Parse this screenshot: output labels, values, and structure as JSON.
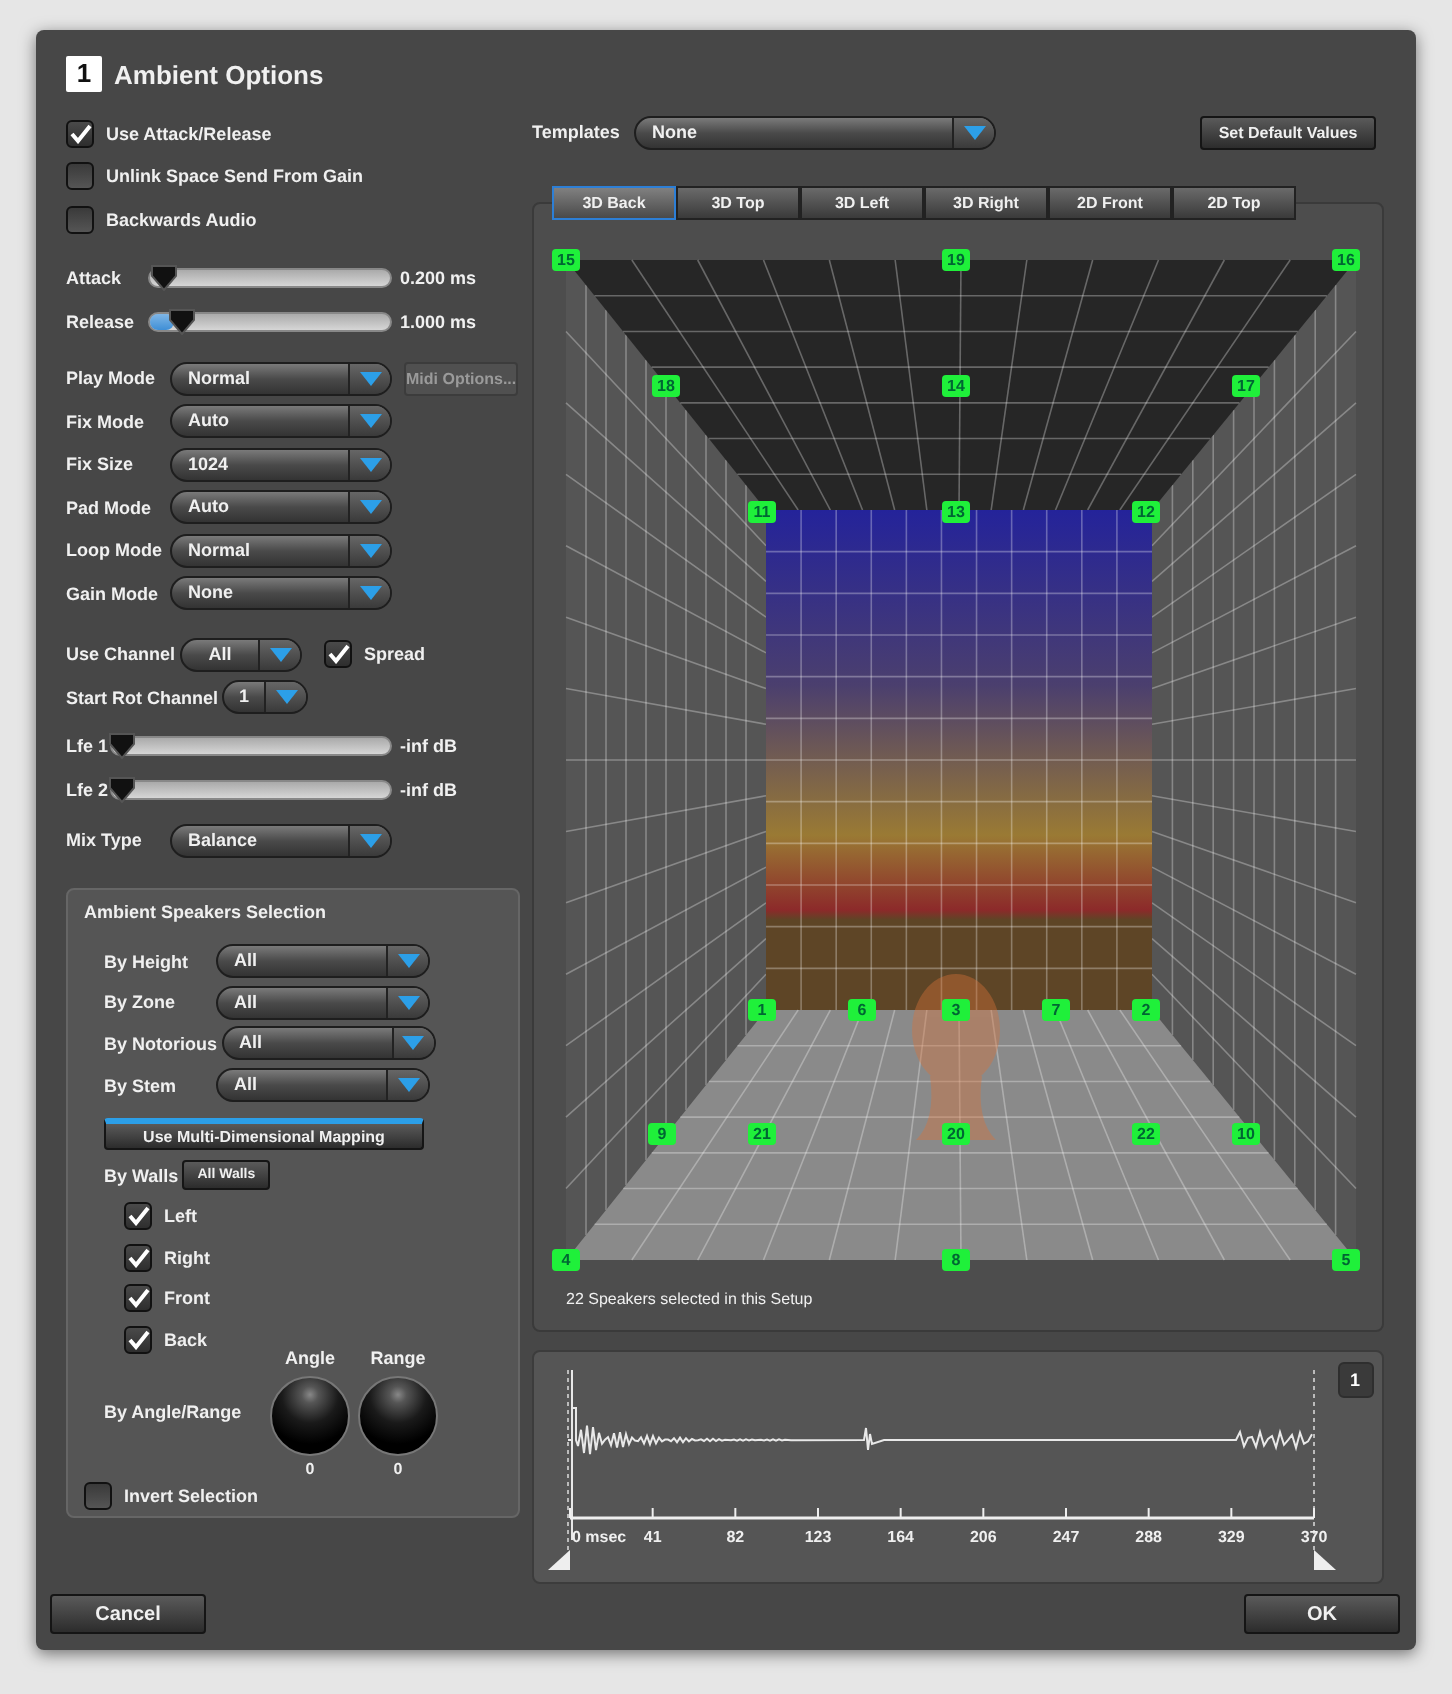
{
  "dialog": {
    "number": "1",
    "title": "Ambient Options"
  },
  "options": [
    {
      "label": "Use Attack/Release",
      "checked": true
    },
    {
      "label": "Unlink Space Send From Gain",
      "checked": false
    },
    {
      "label": "Backwards Audio",
      "checked": false
    }
  ],
  "envelope": [
    {
      "label": "Attack",
      "level": 0.02,
      "reading": "0.200 ms"
    },
    {
      "label": "Release",
      "level": 0.1,
      "reading": "1.000 ms"
    }
  ],
  "modes": [
    {
      "label": "Play Mode",
      "value": "Normal",
      "button": {
        "label": "Midi Options...",
        "disabled": true
      }
    },
    {
      "label": "Fix Mode",
      "value": "Auto"
    },
    {
      "label": "Fix Size",
      "value": "1024"
    },
    {
      "label": "Pad Mode",
      "value": "Auto"
    },
    {
      "label": "Loop Mode",
      "value": "Normal"
    },
    {
      "label": "Gain Mode",
      "value": "None"
    }
  ],
  "use_channel": {
    "label": "Use Channel",
    "value": "All"
  },
  "spread": {
    "label": "Spread",
    "checked": true
  },
  "start_rot_channel": {
    "label": "Start Rot Channel",
    "value": "1"
  },
  "lfe": [
    {
      "label": "Lfe 1",
      "level": 0,
      "reading": "-inf dB"
    },
    {
      "label": "Lfe 2",
      "level": 0,
      "reading": "-inf dB"
    }
  ],
  "mix_type": {
    "label": "Mix Type",
    "value": "Balance"
  },
  "speakers_selection": {
    "title": "Ambient Speakers Selection",
    "filters": [
      {
        "label": "By Height",
        "value": "All"
      },
      {
        "label": "By Zone",
        "value": "All"
      },
      {
        "label": "By Notorious",
        "value": "All"
      },
      {
        "label": "By Stem",
        "value": "All"
      }
    ],
    "mapping_button": "Use Multi-Dimensional Mapping",
    "by_walls": {
      "label": "By Walls",
      "button": "All Walls",
      "walls": [
        {
          "label": "Left",
          "checked": true
        },
        {
          "label": "Right",
          "checked": true
        },
        {
          "label": "Front",
          "checked": true
        },
        {
          "label": "Back",
          "checked": true
        }
      ]
    },
    "by_angle_range": {
      "label": "By Angle/Range",
      "knobs": [
        {
          "label": "Angle",
          "value": "0"
        },
        {
          "label": "Range",
          "value": "0"
        }
      ]
    },
    "invert": {
      "label": "Invert Selection",
      "checked": false
    }
  },
  "templates": {
    "label": "Templates",
    "value": "None"
  },
  "set_default_button": "Set Default Values",
  "view_tabs": [
    {
      "label": "3D Back",
      "selected": true
    },
    {
      "label": "3D Top",
      "selected": false
    },
    {
      "label": "3D Left",
      "selected": false
    },
    {
      "label": "3D Right",
      "selected": false
    },
    {
      "label": "2D Front",
      "selected": false
    },
    {
      "label": "2D Top",
      "selected": false
    }
  ],
  "room": {
    "speakers": [
      {
        "label": "15"
      },
      {
        "label": "19"
      },
      {
        "label": "16"
      },
      {
        "label": "18"
      },
      {
        "label": "14"
      },
      {
        "label": "17"
      },
      {
        "label": "11"
      },
      {
        "label": "13"
      },
      {
        "label": "12"
      },
      {
        "label": "1"
      },
      {
        "label": "6"
      },
      {
        "label": "3"
      },
      {
        "label": "7"
      },
      {
        "label": "2"
      },
      {
        "label": "9"
      },
      {
        "label": "21"
      },
      {
        "label": "20"
      },
      {
        "label": "22"
      },
      {
        "label": "10"
      },
      {
        "label": "4"
      },
      {
        "label": "8"
      },
      {
        "label": "5"
      }
    ],
    "status": "22 Speakers selected in this Setup"
  },
  "waveform": {
    "channel": "1",
    "axis_labels": [
      "0 msec",
      "41",
      "82",
      "123",
      "164",
      "206",
      "247",
      "288",
      "329",
      "370"
    ]
  },
  "buttons": {
    "cancel": "Cancel",
    "ok": "OK"
  }
}
